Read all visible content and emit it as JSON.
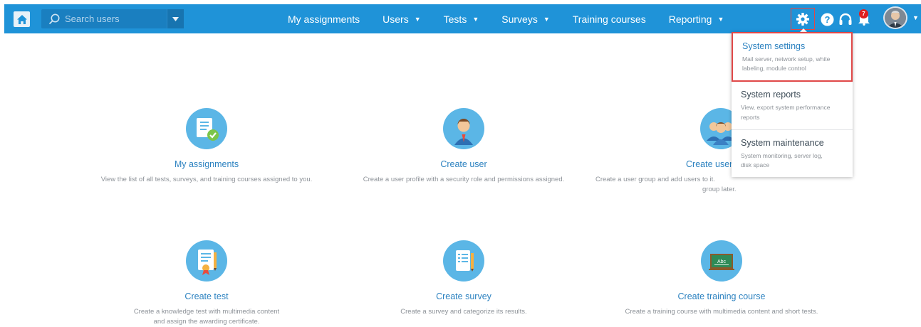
{
  "navbar": {
    "search": {
      "placeholder": "Search users",
      "value": ""
    },
    "links": [
      {
        "label": "My assignments",
        "has_dropdown": false
      },
      {
        "label": "Users",
        "has_dropdown": true
      },
      {
        "label": "Tests",
        "has_dropdown": true
      },
      {
        "label": "Surveys",
        "has_dropdown": true
      },
      {
        "label": "Training courses",
        "has_dropdown": false
      },
      {
        "label": "Reporting",
        "has_dropdown": true
      }
    ],
    "notification_count": "7",
    "icons": [
      "home-icon",
      "search-icon",
      "gear-icon",
      "help-icon",
      "headset-icon",
      "bell-icon"
    ],
    "colors": {
      "bar": "#1f93d8",
      "accent": "#2c82c0",
      "highlight": "#e04848",
      "badge": "#e02020"
    }
  },
  "tiles": [
    {
      "title": "My assignments",
      "desc": "View the list of all tests, surveys, and training courses assigned to you."
    },
    {
      "title": "Create user",
      "desc": "Create a user profile with a security role and permissions assigned."
    },
    {
      "title": "Create user",
      "desc_line1": "Create a user group and add users to it.",
      "desc_line2": "group later."
    },
    {
      "title": "Create test",
      "desc_line1": "Create a knowledge test with multimedia content",
      "desc_line2": "and assign the awarding certificate."
    },
    {
      "title": "Create survey",
      "desc": "Create a survey and categorize its results."
    },
    {
      "title": "Create training course",
      "desc": "Create a training course with multimedia content and short tests."
    }
  ],
  "system_menu": [
    {
      "title": "System settings",
      "desc_line1": "Mail server, network setup, white",
      "desc_line2": "labeling, module control"
    },
    {
      "title": "System reports",
      "desc_line1": "View, export system performance",
      "desc_line2": "reports"
    },
    {
      "title": "System maintenance",
      "desc_line1": "System monitoring, server log,",
      "desc_line2": "disk space"
    }
  ]
}
